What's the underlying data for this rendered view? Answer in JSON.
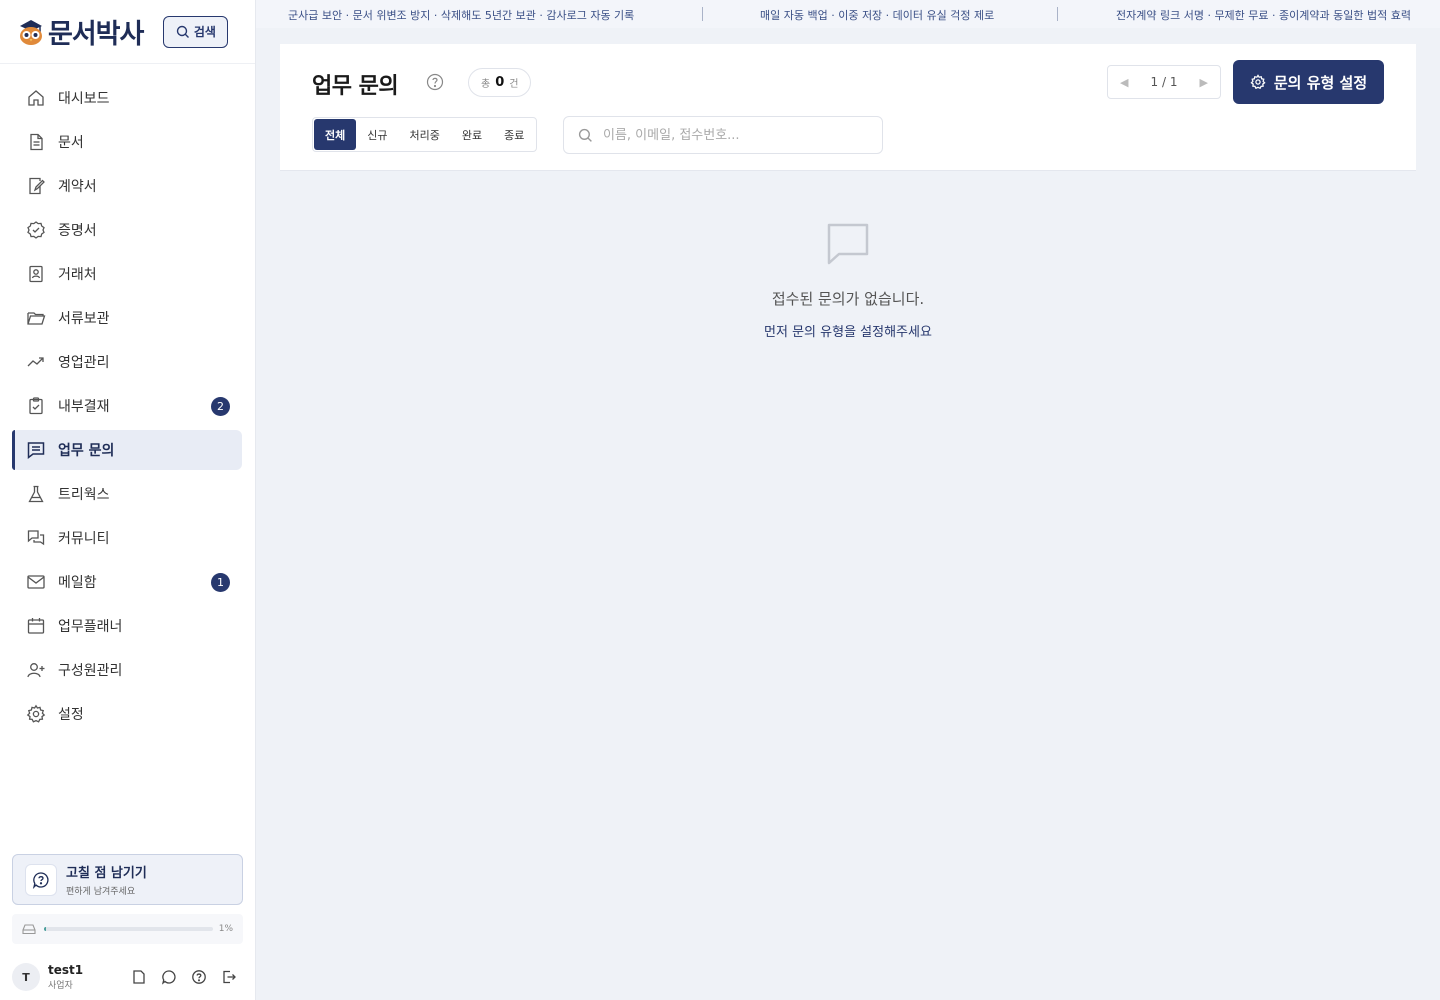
{
  "app": {
    "logo_text": "문서박사",
    "search_label": "검색"
  },
  "topbar": {
    "segments": [
      "군사급 보안 · 문서 위변조 방지 · 삭제해도 5년간 보관 · 감사로그 자동 기록",
      "매일 자동 백업 · 이중 저장 · 데이터 유실 걱정 제로",
      "전자계약 링크 서명 · 무제한 무료 · 종이계약과 동일한 법적 효력"
    ]
  },
  "sidebar": {
    "items": [
      {
        "label": "대시보드",
        "icon": "home-icon"
      },
      {
        "label": "문서",
        "icon": "document-icon"
      },
      {
        "label": "계약서",
        "icon": "contract-icon"
      },
      {
        "label": "증명서",
        "icon": "certificate-icon"
      },
      {
        "label": "거래처",
        "icon": "client-icon"
      },
      {
        "label": "서류보관",
        "icon": "folder-icon"
      },
      {
        "label": "영업관리",
        "icon": "trend-icon"
      },
      {
        "label": "내부결재",
        "icon": "clipboard-icon",
        "badge": "2"
      },
      {
        "label": "업무 문의",
        "icon": "inquiry-icon",
        "active": true
      },
      {
        "label": "트리웍스",
        "icon": "flask-icon"
      },
      {
        "label": "커뮤니티",
        "icon": "chat-icon"
      },
      {
        "label": "메일함",
        "icon": "mail-icon",
        "badge": "1"
      },
      {
        "label": "업무플래너",
        "icon": "calendar-icon"
      },
      {
        "label": "구성원관리",
        "icon": "user-add-icon"
      },
      {
        "label": "설정",
        "icon": "gear-icon"
      }
    ],
    "feedback": {
      "title": "고칠 점 남기기",
      "subtitle": "편하게 남겨주세요"
    },
    "storage": {
      "percent_label": "1%",
      "fraction": 0.01
    },
    "user": {
      "initial": "T",
      "name": "test1",
      "role": "사업자"
    }
  },
  "main": {
    "title": "업무 문의",
    "count": {
      "prefix": "총",
      "value": "0",
      "suffix": "건"
    },
    "pager": {
      "label": "1 / 1"
    },
    "setup_button": "문의 유형 설정",
    "tabs": [
      {
        "label": "전체",
        "active": true
      },
      {
        "label": "신규"
      },
      {
        "label": "처리중"
      },
      {
        "label": "완료"
      },
      {
        "label": "종료"
      }
    ],
    "search": {
      "placeholder": "이름, 이메일, 접수번호...",
      "value": ""
    },
    "empty": {
      "title": "접수된 문의가 없습니다.",
      "link": "먼저 문의 유형을 설정해주세요"
    }
  },
  "colors": {
    "primary": "#27386e",
    "accent_teal": "#4a9e9b",
    "background": "#eff2f7"
  }
}
